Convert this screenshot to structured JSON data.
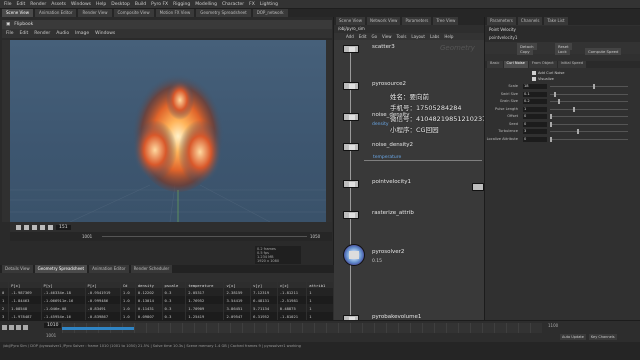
{
  "menubar": [
    "File",
    "Edit",
    "Render",
    "Assets",
    "Windows",
    "Help",
    "Desktop",
    "Build",
    "Pyro FX",
    "Rigging",
    "Modelling",
    "Character",
    "FX",
    "Lighting"
  ],
  "top_tabs": [
    "Scene View",
    "Animation Editor",
    "Render View",
    "Composite View",
    "Motion FX View",
    "Geometry Spreadsheet",
    "DOP_network"
  ],
  "viewer": {
    "title": "Flipbook",
    "flip_menu": [
      "File",
      "Edit",
      "Render",
      "Audio",
      "Image",
      "Windows"
    ],
    "frame": "151",
    "start": "1001",
    "end": "1050",
    "stats": [
      "0.2 frames",
      "0.5 fps",
      "1.234 MB",
      "1920 x 1080"
    ]
  },
  "sheet": {
    "tabs": [
      "Details View",
      "Geometry Spreadsheet",
      "Animation Editor",
      "Render Scheduler"
    ],
    "headers": [
      "",
      "P[x]",
      "P[y]",
      "P[z]",
      "Cd",
      "density",
      "pscale",
      "temperature",
      "v[x]",
      "v[y]",
      "v[z]",
      "attrib1"
    ],
    "rows": [
      [
        "0",
        "-1.987369",
        "-1.46334e-18",
        "-0.9541919",
        "1.0",
        "0.12202",
        "0.3",
        "2.05317",
        "2.38159",
        "7.12319",
        "-1.81211",
        "1"
      ],
      [
        "1",
        "-1.84463",
        "-1.066911e-16",
        "-0.999486",
        "1.0",
        "0.13014",
        "0.3",
        "1.76952",
        "3.54419",
        "6.48131",
        "-2.51981",
        "1"
      ],
      [
        "2",
        "1.08548",
        "-1.046e-08",
        "-0.83491",
        "1.0",
        "0.11431",
        "0.3",
        "1.70909",
        "3.86451",
        "5.71134",
        "0.48875",
        "1"
      ],
      [
        "3",
        "-1.978487",
        "-1.45954e-16",
        "-0.839867",
        "1.0",
        "0.09807",
        "0.3",
        "1.25419",
        "2.09547",
        "6.31952",
        "-1.81021",
        "1"
      ]
    ]
  },
  "timeline": {
    "frame": "1010",
    "start_label": "1001",
    "end_label": "1100",
    "progress": 0.15,
    "buttons": [
      "Auto Update",
      "Key Channels"
    ]
  },
  "status_text": "/obj/Pyro Sim / DOP /pyrosolver1 /Pyro Solver : frame 1010 (1001 to 1050) 21.5% | Solve time 10.3s | Scene memory 1.4 GB | Cached frames 9 | pyrosolver1 working",
  "network": {
    "tabs": [
      "Scene View",
      "Network View",
      "Parameters",
      "Tree View"
    ],
    "path": "/obj/pyro_sim",
    "menu": [
      "Add",
      "Edit",
      "Go",
      "View",
      "Tools",
      "Layout",
      "Labs",
      "Help"
    ],
    "context_label": "Geometry",
    "nodes": [
      {
        "name": "scatter3",
        "sub": "",
        "color": "#c8c8c8"
      },
      {
        "name": "pyrosource2",
        "sub": "",
        "color": "#c8c8c8"
      },
      {
        "name": "noise_density",
        "sub": "density",
        "color": "#6aa8e8"
      },
      {
        "name": "noise_density2",
        "sub": "",
        "color": "#c8c8c8"
      },
      {
        "name": "temperature",
        "sub": "",
        "color": "#6aa8e8"
      },
      {
        "name": "pointvelocity1",
        "sub": "",
        "color": "#c8c8c8"
      },
      {
        "name": "rasterize_attrib",
        "sub": "",
        "color": "#c8c8c8"
      },
      {
        "name": "pyrosolver2",
        "sub": "0.15",
        "color": "#c8c8c8"
      },
      {
        "name": "pyrobakevolume1",
        "sub": "",
        "color": "#c8c8c8"
      }
    ],
    "overlay": {
      "line1": "姓名：要向前",
      "line2": "手机号：17505284284",
      "line3": "微信号：41048219851210237",
      "line4": "小程序：CG回园"
    }
  },
  "params": {
    "tabs": [
      "Parameters",
      "Channels",
      "Take List"
    ],
    "node_type": "Point Velocity",
    "node_name": "pointvelocity1",
    "buttons": [
      "Detach",
      "Reset",
      "Copy",
      "Lock",
      "Compute Speed"
    ],
    "section_tabs": [
      "Basic",
      "Curl Noise",
      "From Object",
      "Initial Speed"
    ],
    "checks": [
      "Add Curl Noise",
      "Visualize"
    ],
    "rows": [
      {
        "label": "Scale",
        "value": "18",
        "fill": 0.55
      },
      {
        "label": "Swirl Size",
        "value": "0.1",
        "fill": 0.05
      },
      {
        "label": "Grain Size",
        "value": "0.2",
        "fill": 0.1
      },
      {
        "label": "Pulse Length",
        "value": "1",
        "fill": 0.3
      },
      {
        "label": "Offset",
        "value": "0",
        "fill": 0.0
      },
      {
        "label": "Seed",
        "value": "0",
        "fill": 0.0
      },
      {
        "label": "Turbulence",
        "value": "3",
        "fill": 0.35
      },
      {
        "label": "Localize Attribute",
        "value": "0",
        "fill": 0.0
      }
    ]
  }
}
